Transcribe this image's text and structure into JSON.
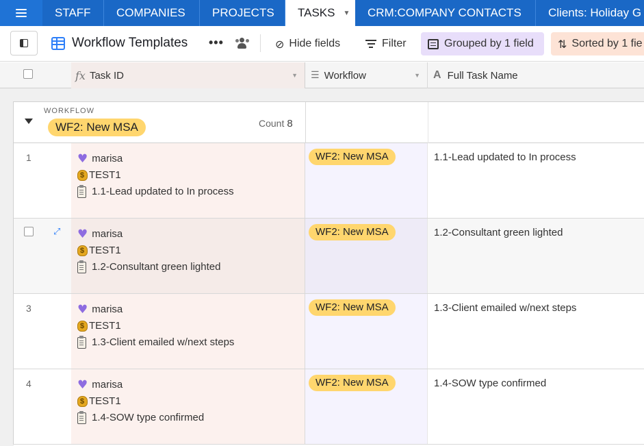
{
  "tabs": [
    {
      "label": "STAFF"
    },
    {
      "label": "COMPANIES"
    },
    {
      "label": "PROJECTS"
    },
    {
      "label": "TASKS"
    },
    {
      "label": "CRM:COMPANY CONTACTS"
    },
    {
      "label": "Clients: Holiday G"
    }
  ],
  "toolbar": {
    "view_name": "Workflow Templates",
    "more_label": "•••",
    "hide_fields": "Hide fields",
    "filter": "Filter",
    "grouped": "Grouped by 1 field",
    "sorted": "Sorted by 1 fie"
  },
  "columns": {
    "task_id": "Task ID",
    "workflow": "Workflow",
    "full_name": "Full Task Name"
  },
  "group": {
    "label": "WORKFLOW",
    "value": "WF2: New MSA",
    "count_label": "Count",
    "count": "8"
  },
  "rows": [
    {
      "num": "1",
      "person": "marisa",
      "project": "TEST1",
      "task": "1.1-Lead updated to In process",
      "workflow": "WF2: New MSA",
      "full_name": "1.1-Lead updated to In process"
    },
    {
      "num": "",
      "person": "marisa",
      "project": "TEST1",
      "task": "1.2-Consultant green lighted",
      "workflow": "WF2: New MSA",
      "full_name": "1.2-Consultant green lighted"
    },
    {
      "num": "3",
      "person": "marisa",
      "project": "TEST1",
      "task": "1.3-Client emailed w/next steps",
      "workflow": "WF2: New MSA",
      "full_name": "1.3-Client emailed w/next steps"
    },
    {
      "num": "4",
      "person": "marisa",
      "project": "TEST1",
      "task": "1.4-SOW type confirmed",
      "workflow": "WF2: New MSA",
      "full_name": "1.4-SOW type confirmed"
    }
  ],
  "colors": {
    "tabbar": "#1f73d6",
    "pill": "#ffd66e",
    "grouped_bg": "#e8defa",
    "sorted_bg": "#fde3d6"
  }
}
